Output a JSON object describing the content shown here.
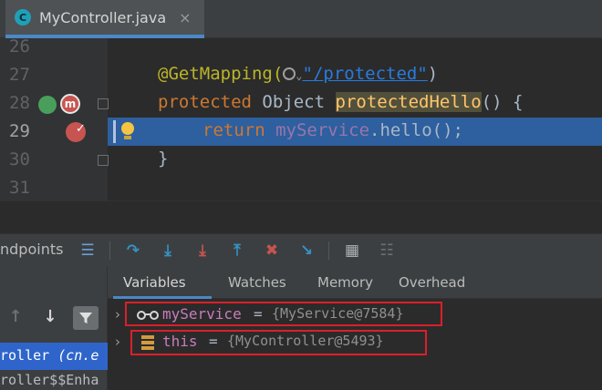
{
  "tab": {
    "icon_letter": "C",
    "label": "MyController.java",
    "close": "×"
  },
  "editor": {
    "line_numbers": [
      "26",
      "27",
      "28",
      "29",
      "30",
      "31"
    ],
    "current_line": "29",
    "annotation": "@GetMapping(",
    "annotation_dropdown": "⌄",
    "path": "\"/protected\"",
    "annotation_close": ")",
    "kw_protected": "protected",
    "type_object": "Object",
    "method_name": "protectedHello",
    "method_tail": "() {",
    "kw_return": "return",
    "field": "myService",
    "call_tail": ".hello();",
    "closing_brace": "}",
    "gutter_marker": "m"
  },
  "debug_toolbar": {
    "label": "ndpoints",
    "icons": [
      "frames-menu-icon",
      "step-over-icon",
      "step-into-icon",
      "force-step-into-icon",
      "step-out-icon",
      "drop-frame-icon",
      "run-to-cursor-icon",
      "evaluate-icon",
      "trace-icon"
    ]
  },
  "frames": {
    "up_arrow": "↑",
    "down_arrow": "↓",
    "frame1_name": "roller ",
    "frame1_pkg": "(cn.e",
    "frame2": "roller$$Enha"
  },
  "variables_tabs": {
    "items": [
      "Variables",
      "Watches",
      "Memory",
      "Overhead"
    ],
    "active": "Variables"
  },
  "variables": [
    {
      "expander": "›",
      "name": "myService",
      "eq": "=",
      "value": "{MyService@7584}"
    },
    {
      "expander": "›",
      "name": "this",
      "eq": "=",
      "value": "{MyController@5493}"
    }
  ],
  "colors": {
    "highlight_line": "#2e5f9e",
    "accent": "#4a88c7",
    "annotation_box": "#d9202a"
  }
}
